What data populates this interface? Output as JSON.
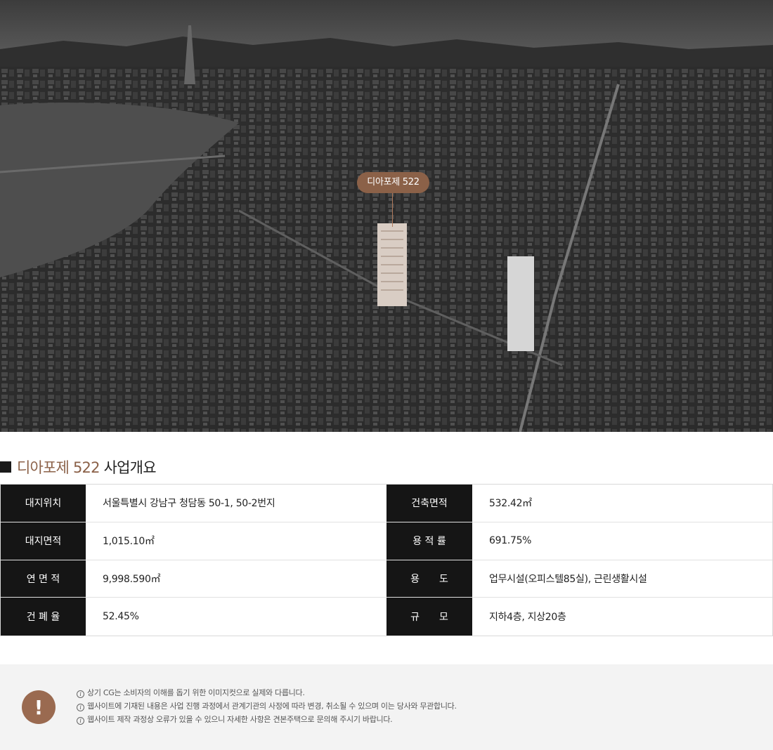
{
  "hero": {
    "callout_label": "디아포제 522"
  },
  "section": {
    "brand": "디아포제 522",
    "rest": "사업개요"
  },
  "overview": {
    "left": [
      {
        "label": "대지위치",
        "value": "서울특별시 강남구 청담동 50-1, 50-2번지"
      },
      {
        "label": "대지면적",
        "value": "1,015.10㎡"
      },
      {
        "label": "연 면 적",
        "value": "9,998.590㎡"
      },
      {
        "label": "건 폐 율",
        "value": "52.45%"
      }
    ],
    "right": [
      {
        "label": "건축면적",
        "value": "532.42㎡"
      },
      {
        "label": "용 적 률",
        "value": "691.75%"
      },
      {
        "label": "용　　도",
        "value": "업무시설(오피스텔85실), 근린생활시설"
      },
      {
        "label": "규　　모",
        "value": "지하4층, 지상20층"
      }
    ]
  },
  "notice": {
    "badge": "!",
    "info_glyph": "i",
    "items": [
      "상기 CG는 소비자의 이해를 돕기 위한 이미지컷으로 실제와 다릅니다.",
      "웹사이트에 기재된 내용은 사업 진행 과정에서 관계기관의 사정에 따라 변경, 취소될 수 있으며 이는 당사와 무관합니다.",
      "웹사이트 제작 과정상 오류가 있을 수 있으니 자세한 사항은 견본주택으로 문의해 주시기 바랍니다."
    ]
  },
  "colors": {
    "brand_brown": "#8b6148",
    "header_dark": "#151515",
    "notice_bg": "#f3f3f3"
  }
}
